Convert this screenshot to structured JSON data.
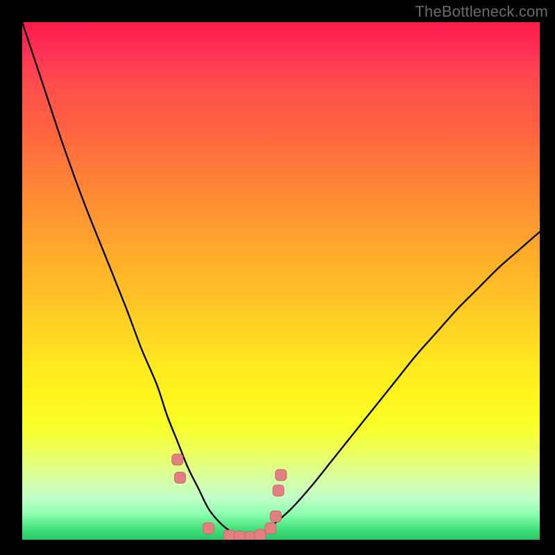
{
  "watermark": "TheBottleneck.com",
  "colors": {
    "frame_border": "#000000",
    "curve_stroke": "#000000",
    "marker_fill": "#e08080",
    "marker_stroke": "#d06868",
    "gradient_top": "#ff1a4d",
    "gradient_bottom": "#28c868"
  },
  "chart_data": {
    "type": "line",
    "title": "",
    "xlabel": "",
    "ylabel": "",
    "xlim": [
      0,
      100
    ],
    "ylim": [
      0,
      100
    ],
    "x": [
      0,
      4,
      8,
      12,
      16,
      20,
      23,
      26,
      28,
      30,
      32,
      34,
      36,
      38,
      40,
      42,
      44,
      46,
      48,
      52,
      56,
      60,
      64,
      68,
      72,
      76,
      80,
      84,
      88,
      92,
      96,
      100
    ],
    "values": [
      100,
      88,
      76,
      65,
      55,
      45,
      37,
      30,
      24,
      19,
      14,
      10,
      6,
      3.5,
      1.8,
      0.8,
      0.5,
      1.0,
      2.5,
      6,
      10.5,
      15.5,
      20.5,
      25.5,
      30.5,
      35.5,
      40,
      44.5,
      48.5,
      52.5,
      56,
      59.5
    ],
    "markers": {
      "x": [
        30,
        30.5,
        36,
        40,
        42,
        44,
        46,
        48,
        49,
        49.5,
        50
      ],
      "y": [
        15.5,
        12,
        2.2,
        0.8,
        0.6,
        0.5,
        0.9,
        2.2,
        4.5,
        9.5,
        12.5
      ]
    },
    "notes": "V-shaped bottleneck curve over vertical red-to-green gradient; minimum (optimal) near x≈44 where y≈0.5. Values are percentages estimated from pixel positions; no axis ticks are shown in the image."
  }
}
